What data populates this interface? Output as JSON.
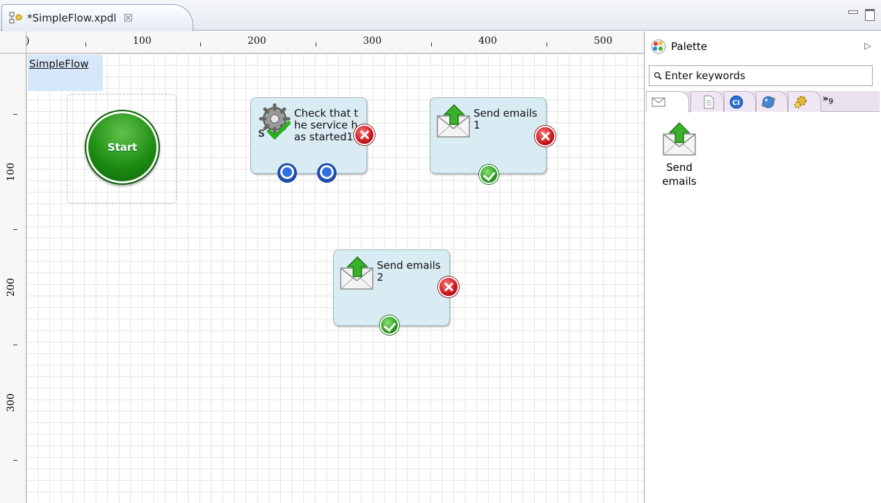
{
  "editor": {
    "tab_title": "*SimpleFlow.xpdl",
    "tab_close": "☒"
  },
  "rulers": {
    "horizontal": [
      "100",
      "200",
      "300",
      "400",
      "500"
    ],
    "horizontal_partial": ")",
    "vertical": [
      "100",
      "200",
      "300"
    ]
  },
  "canvas": {
    "pool_name": "SimpleFlow",
    "start_event_label": "Start",
    "tasks": [
      {
        "label": "Check that the service has started1",
        "icon": "service-check-icon"
      },
      {
        "label": "Send emails1",
        "icon": "send-email-icon"
      },
      {
        "label": "Send emails2",
        "icon": "send-email-icon"
      }
    ]
  },
  "palette": {
    "title": "Palette",
    "collapse_glyph": "▷",
    "search_placeholder": "Enter keywords",
    "tabs": [
      {
        "icon": "envelope-icon"
      },
      {
        "icon": "document-icon"
      },
      {
        "icon": "ci-icon"
      },
      {
        "icon": "globe-icon"
      },
      {
        "icon": "gears-icon"
      }
    ],
    "more_label": "»",
    "more_count": "9",
    "item_label": "Send emails"
  },
  "colors": {
    "task_fill": "#d9ecf3",
    "start_green": "#1d8c13",
    "error_red": "#c8141a",
    "port_blue": "#2f6fe0",
    "pool_label_bg": "#d6e6fb"
  }
}
